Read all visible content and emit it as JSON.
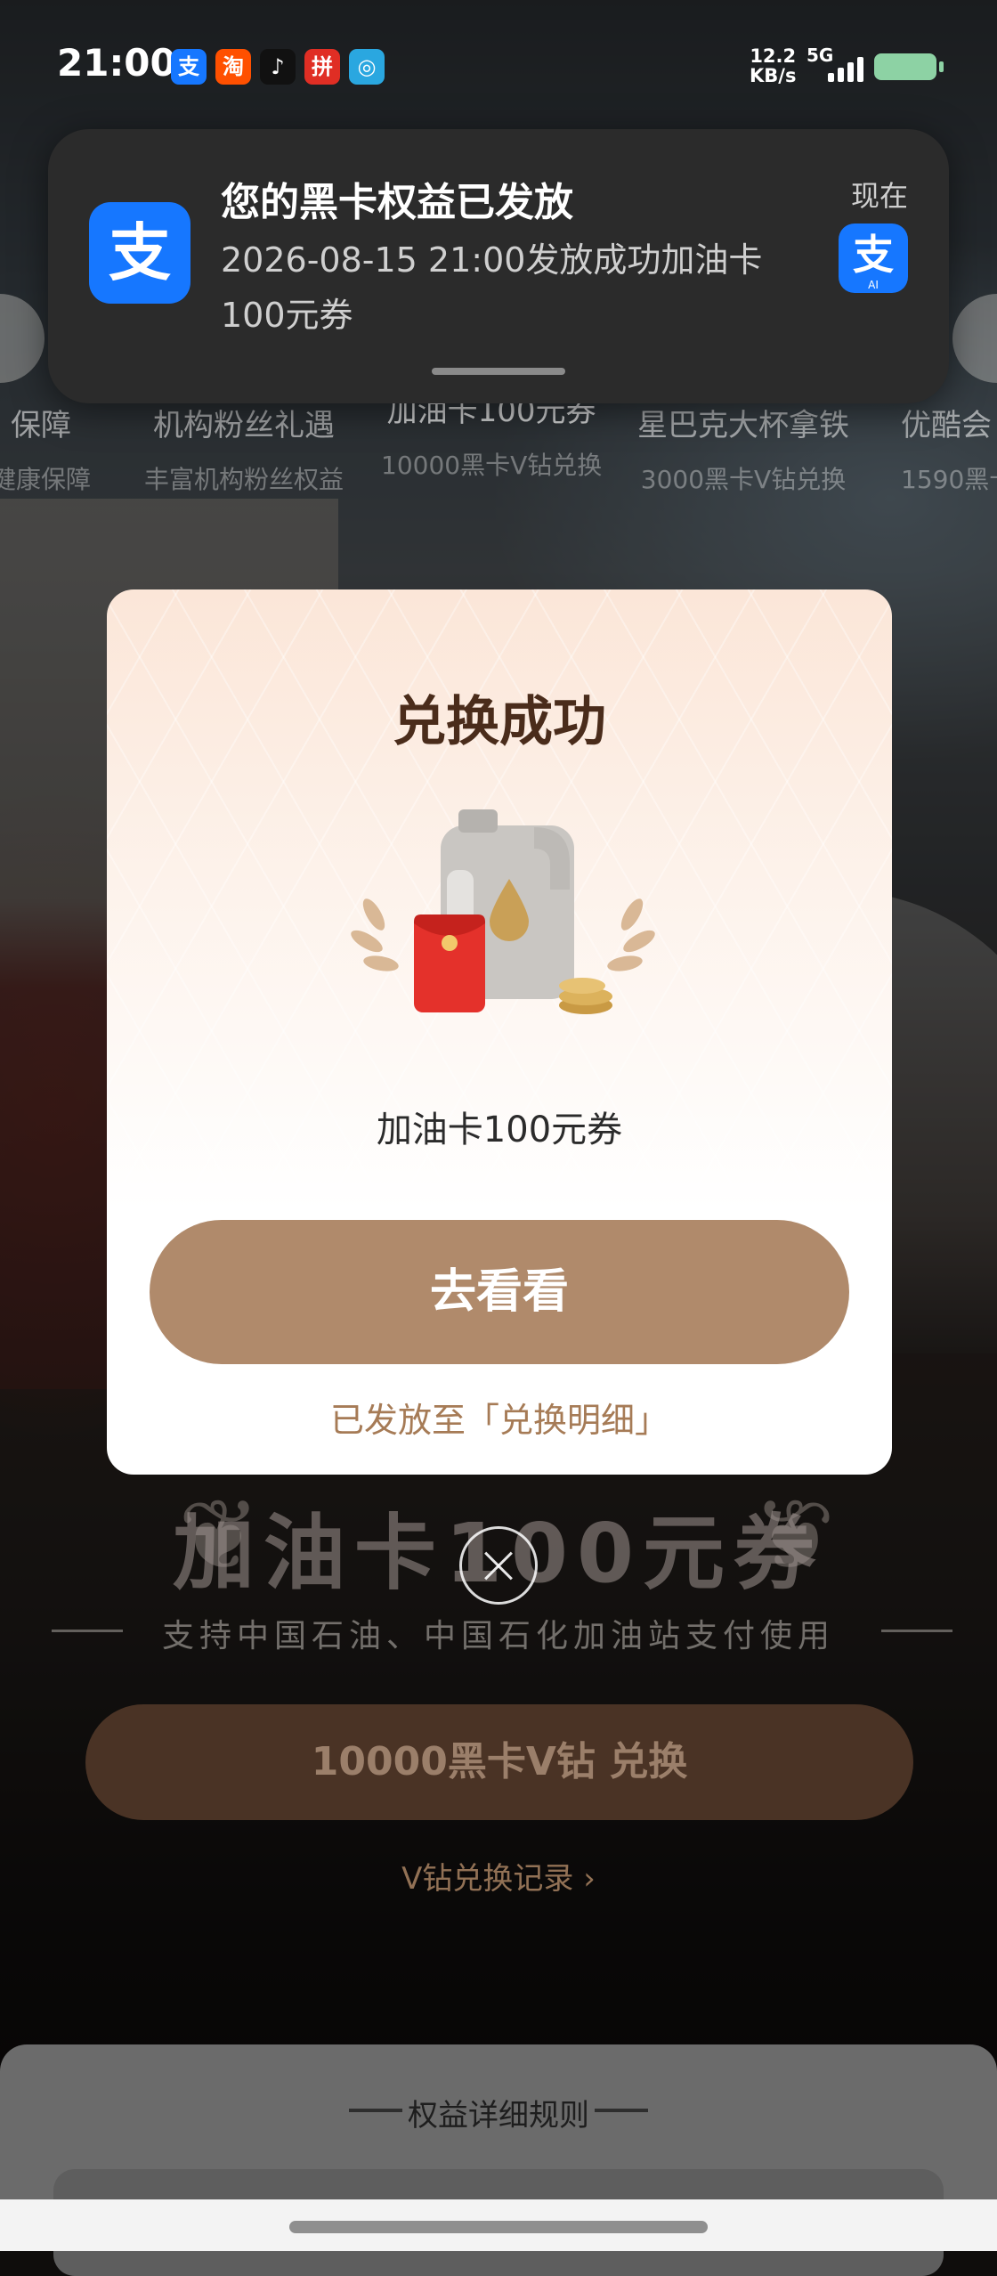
{
  "status_bar": {
    "time": "21:00",
    "app_icons": [
      {
        "name": "alipay-icon",
        "glyph": "支",
        "color": "#1677ff"
      },
      {
        "name": "taobao-icon",
        "glyph": "淘",
        "color": "#ff5000"
      },
      {
        "name": "douyin-icon",
        "glyph": "♪",
        "color": "#111111"
      },
      {
        "name": "pinduoduo-icon",
        "glyph": "拼",
        "color": "#e02e24"
      },
      {
        "name": "app-icon",
        "glyph": "◎",
        "color": "#2aa7e0"
      }
    ],
    "net_speed_value": "12.2",
    "net_speed_unit": "KB/s",
    "signal_label": "5G"
  },
  "notification": {
    "app_glyph": "支",
    "title": "您的黑卡权益已发放",
    "body": "2026-08-15 21:00发放成功加油卡100元券",
    "time": "现在",
    "badge_glyph": "支",
    "badge_text": "AI"
  },
  "background": {
    "categories": [
      {
        "title": "保障",
        "subtitle": "健康保障"
      },
      {
        "title": "机构粉丝礼遇",
        "subtitle": "丰富机构粉丝权益"
      },
      {
        "title": "加油卡100元券",
        "subtitle": "10000黑卡V钻兑换"
      },
      {
        "title": "星巴克大杯拿铁",
        "subtitle": "3000黑卡V钻兑换"
      },
      {
        "title": "优酷会",
        "subtitle": "1590黑卡"
      }
    ],
    "product_title": "加油卡100元券",
    "product_subtitle": "支持中国石油、中国石化加油站支付使用",
    "redeem_button": "10000黑卡V钻 兑换",
    "records_link": "V钻兑换记录 ›",
    "rules_title": "权益详细规则"
  },
  "modal": {
    "title": "兑换成功",
    "prize_name": "加油卡100元券",
    "button_label": "去看看",
    "note": "已发放至「兑换明细」"
  },
  "colors": {
    "alipay_blue": "#1677ff",
    "button_brown": "#b08a6b",
    "title_brown": "#4a2c1b",
    "note_brown": "#a67b56"
  }
}
